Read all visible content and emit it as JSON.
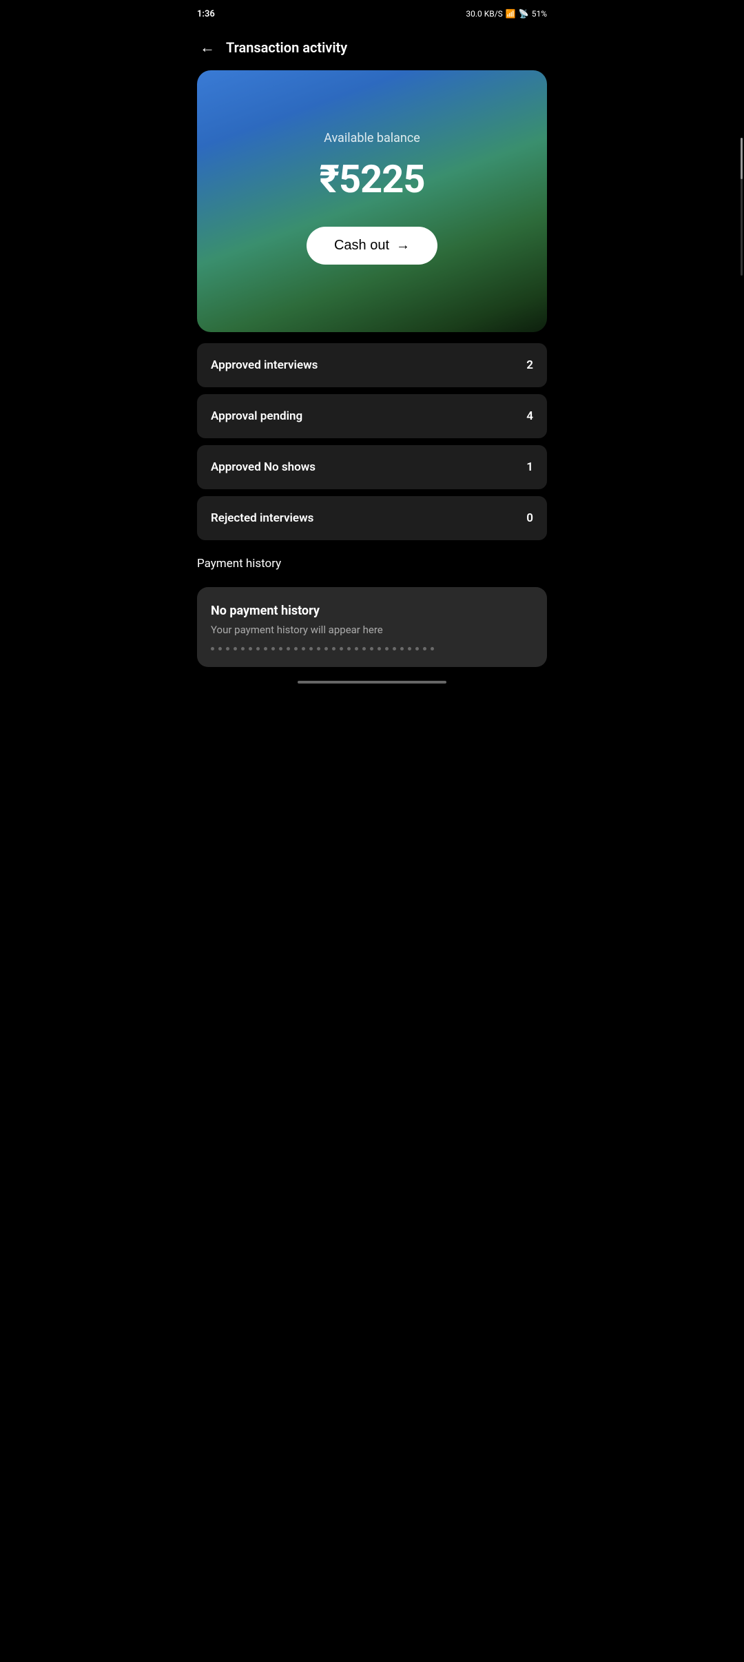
{
  "statusBar": {
    "time": "1:36",
    "battery": "51%",
    "network": "30.0 KB/S"
  },
  "header": {
    "backLabel": "←",
    "title": "Transaction activity"
  },
  "balanceCard": {
    "label": "Available balance",
    "amount": "₹5225",
    "cashOutLabel": "Cash out",
    "cashOutArrow": "→"
  },
  "stats": [
    {
      "label": "Approved interviews",
      "value": "2"
    },
    {
      "label": "Approval pending",
      "value": "4"
    },
    {
      "label": "Approved No shows",
      "value": "1"
    },
    {
      "label": "Rejected interviews",
      "value": "0"
    }
  ],
  "paymentHistory": {
    "title": "Payment history",
    "emptyTitle": "No payment history",
    "emptySubtitle": "Your payment history will appear here"
  }
}
